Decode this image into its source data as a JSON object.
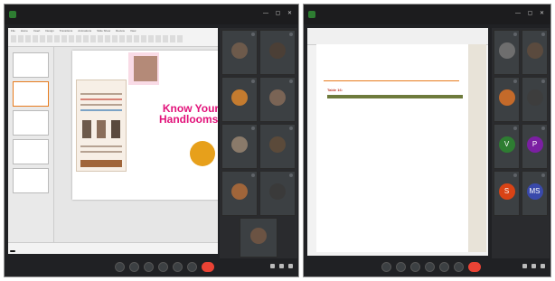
{
  "left": {
    "window_title": "",
    "ribbon_tabs": [
      "File",
      "Home",
      "Insert",
      "Design",
      "Transitions",
      "Animations",
      "Slide Show",
      "Review",
      "View"
    ],
    "slide": {
      "headline": "Know Your Handlooms...",
      "poster_title": ""
    },
    "screen_share_banner": "",
    "meeting_time": "",
    "participants": [
      {
        "name": "",
        "tone": "#6d5a4b"
      },
      {
        "name": "",
        "tone": "#4b3f36"
      },
      {
        "name": "",
        "tone": "#c47b2f"
      },
      {
        "name": "",
        "tone": "#7a6455"
      },
      {
        "name": "",
        "tone": "#8a7a6a"
      },
      {
        "name": "",
        "tone": "#5b4a3a"
      },
      {
        "name": "",
        "tone": "#a0653a"
      },
      {
        "name": "",
        "tone": "#3a3a3a"
      },
      {
        "name": "",
        "tone": "#6b5343"
      }
    ]
  },
  "right": {
    "window_title": "",
    "doc_header": "",
    "doc_subtitle": "",
    "table_caption_lead": "Table 16:",
    "table_caption": "",
    "table_headers": [
      "",
      "",
      "",
      ""
    ],
    "table_rows": [],
    "footnote": "",
    "meeting_time": "",
    "participants": [
      {
        "name": "",
        "tone": "#6e6e6e",
        "initial": ""
      },
      {
        "name": "",
        "tone": "#5a4a3e",
        "initial": ""
      },
      {
        "name": "",
        "tone": "#c46a2a",
        "initial": ""
      },
      {
        "name": "",
        "tone": "#3d3d3d",
        "initial": ""
      },
      {
        "name": "",
        "tone": "#2e7d32",
        "initial": "V"
      },
      {
        "name": "",
        "tone": "#7b1fa2",
        "initial": "P"
      },
      {
        "name": "",
        "tone": "#d84315",
        "initial": "S"
      },
      {
        "name": "",
        "tone": "#3949ab",
        "initial": "MS"
      },
      {
        "name": "",
        "tone": "#5f5a52",
        "initial": ""
      }
    ]
  },
  "colors": {
    "accent_pink": "#e2127a",
    "sun": "#e7a01b",
    "meet_red": "#ea4335",
    "table_header": "#6e7b3c"
  },
  "icons": [
    "mic-icon",
    "camera-icon",
    "present-icon",
    "raise-hand-icon",
    "more-icon",
    "end-call-icon",
    "info-icon",
    "people-icon",
    "chat-icon"
  ]
}
